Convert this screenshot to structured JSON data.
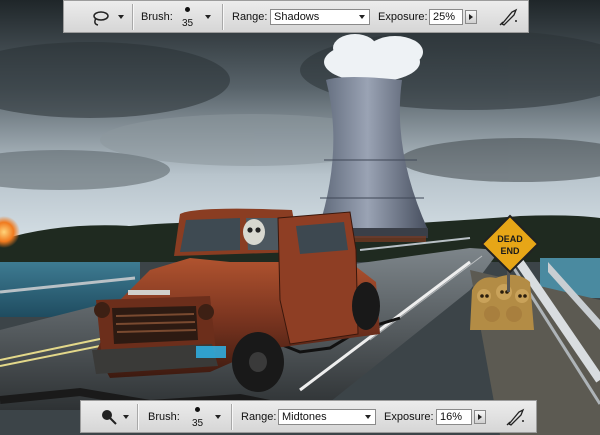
{
  "top_toolbar": {
    "tool_icon": "dodge-tool-icon",
    "brush_label": "Brush:",
    "brush_size": "35",
    "range_label": "Range:",
    "range_value": "Shadows",
    "exposure_label": "Exposure:",
    "exposure_value": "25%",
    "airbrush_icon": "airbrush-icon"
  },
  "bottom_toolbar": {
    "tool_icon": "burn-tool-icon",
    "brush_label": "Brush:",
    "brush_size": "35",
    "range_label": "Range:",
    "range_value": "Midtones",
    "exposure_label": "Exposure:",
    "exposure_value": "16%",
    "airbrush_icon": "airbrush-icon"
  },
  "canvas": {
    "sign_line1": "DEAD",
    "sign_line2": "END"
  }
}
